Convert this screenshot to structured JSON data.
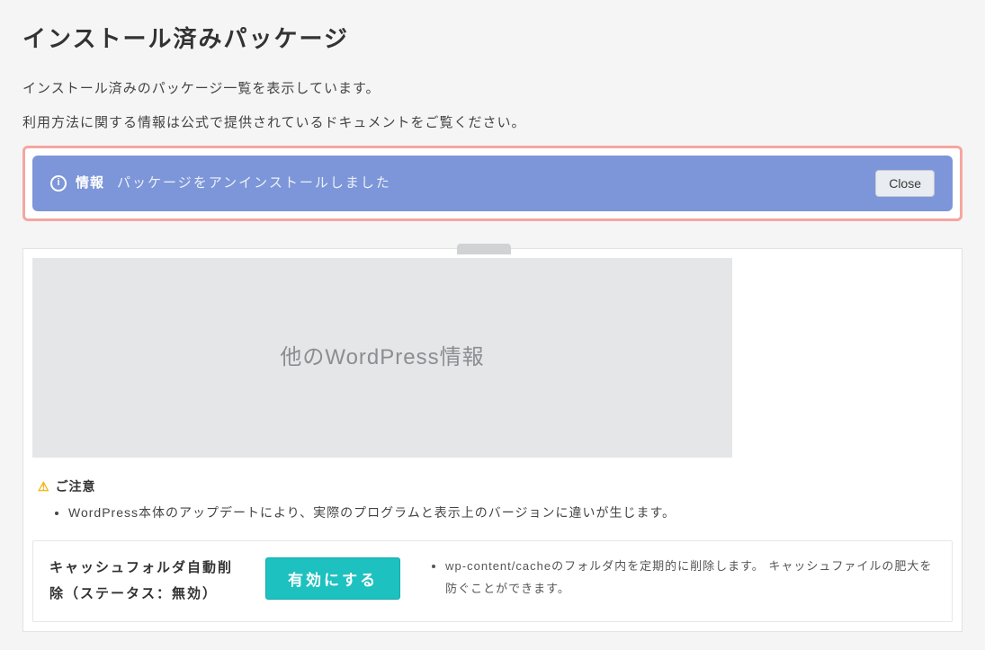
{
  "page": {
    "title": "インストール済みパッケージ",
    "desc_line1": "インストール済みのパッケージ一覧を表示しています。",
    "desc_line2": "利用方法に関する情報は公式で提供されているドキュメントをご覧ください。"
  },
  "alert": {
    "icon_glyph": "i",
    "label": "情報",
    "message": "パッケージをアンインストールしました",
    "close": "Close"
  },
  "placeholder": {
    "text": "他のWordPress情報"
  },
  "caution": {
    "heading": "ご注意",
    "items": [
      "WordPress本体のアップデートにより、実際のプログラムと表示上のバージョンに違いが生じます。"
    ]
  },
  "cache_setting": {
    "label": "キャッシュフォルダ自動削除（ステータス：無効）",
    "button": "有効にする",
    "desc": "wp-content/cacheのフォルダ内を定期的に削除します。 キャッシュファイルの肥大を防ぐことができます。"
  }
}
